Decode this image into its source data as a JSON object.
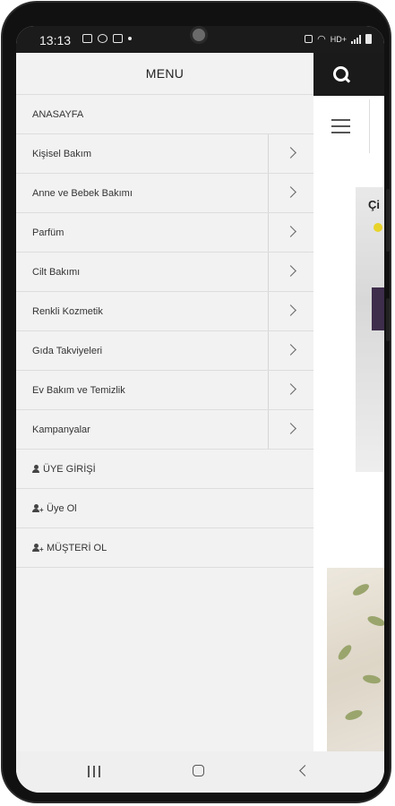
{
  "status_bar": {
    "time": "13:13",
    "network": "HD+"
  },
  "menu": {
    "title": "MENU",
    "items": [
      {
        "label": "ANASAYFA",
        "has_submenu": false
      },
      {
        "label": "Kişisel Bakım",
        "has_submenu": true
      },
      {
        "label": "Anne ve Bebek Bakımı",
        "has_submenu": true
      },
      {
        "label": "Parfüm",
        "has_submenu": true
      },
      {
        "label": "Cilt Bakımı",
        "has_submenu": true
      },
      {
        "label": "Renkli Kozmetik",
        "has_submenu": true
      },
      {
        "label": "Gıda Takviyeleri",
        "has_submenu": true
      },
      {
        "label": "Ev Bakım ve Temizlik",
        "has_submenu": true
      },
      {
        "label": "Kampanyalar",
        "has_submenu": true
      }
    ],
    "account_items": [
      {
        "label": "ÜYE GİRİŞİ",
        "icon": "user-icon"
      },
      {
        "label": "Üye Ol",
        "icon": "user-plus-icon"
      },
      {
        "label": "MÜŞTERİ OL",
        "icon": "user-plus-icon"
      }
    ]
  },
  "background_page": {
    "banner_text": "Çi"
  },
  "colors": {
    "header_dark": "#1a1a1a",
    "menu_bg": "#f2f2f2"
  }
}
